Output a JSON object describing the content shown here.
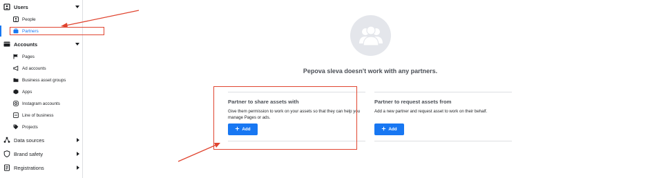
{
  "sidebar": {
    "sections": [
      {
        "label": "Users",
        "icon": "users-icon",
        "expanded": true
      },
      {
        "label": "Accounts",
        "icon": "accounts-icon",
        "expanded": true
      },
      {
        "label": "Data sources",
        "icon": "data-sources-icon",
        "expanded": false
      },
      {
        "label": "Brand safety",
        "icon": "shield-icon",
        "expanded": false
      },
      {
        "label": "Registrations",
        "icon": "registrations-icon",
        "expanded": false
      }
    ],
    "users_items": [
      {
        "label": "People",
        "icon": "person-icon"
      },
      {
        "label": "Partners",
        "icon": "briefcase-icon",
        "active": true
      }
    ],
    "accounts_items": [
      {
        "label": "Pages",
        "icon": "flag-icon"
      },
      {
        "label": "Ad accounts",
        "icon": "megaphone-icon"
      },
      {
        "label": "Business asset groups",
        "icon": "folder-icon"
      },
      {
        "label": "Apps",
        "icon": "cube-icon"
      },
      {
        "label": "Instagram accounts",
        "icon": "instagram-icon"
      },
      {
        "label": "Line of business",
        "icon": "link-icon"
      },
      {
        "label": "Projects",
        "icon": "tag-icon"
      }
    ]
  },
  "main": {
    "empty_title": "Pepova sleva doesn't work with any partners.",
    "share": {
      "title": "Partner to share assets with",
      "description": "Give them permission to work on your assets so that they can help you manage Pages or ads.",
      "button_label": "Add"
    },
    "request": {
      "title": "Partner to request assets from",
      "description": "Add a new partner and request asset to work on their behalf.",
      "button_label": "Add"
    }
  },
  "colors": {
    "accent": "#1877f2",
    "annotation": "#e0442f"
  }
}
